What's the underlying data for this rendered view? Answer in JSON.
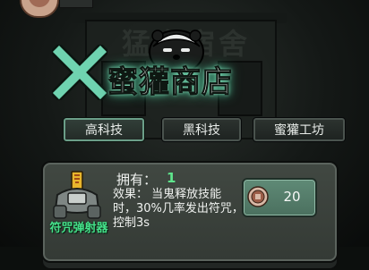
{
  "bg_sign": "猛鬼宿舍",
  "shop": {
    "title": "蜜獾商店",
    "tabs": [
      {
        "label": "高科技",
        "active": true
      },
      {
        "label": "黑科技",
        "active": false
      },
      {
        "label": "蜜獾工坊",
        "active": false
      }
    ]
  },
  "item": {
    "name": "符咒弹射器",
    "own_label": "拥有：",
    "own_count": "1",
    "effect": "效果：  当鬼释放技能时，30%几率发出符咒，控制3s",
    "price": "20"
  },
  "icons": {
    "close": "close-x-icon",
    "coin": "coin-icon",
    "mascot": "honey-badger-mascot"
  },
  "colors": {
    "accent": "#5fc9a0",
    "item_name": "#45e08a",
    "own_count": "#5ee58c",
    "price_button": "#5a8571"
  }
}
